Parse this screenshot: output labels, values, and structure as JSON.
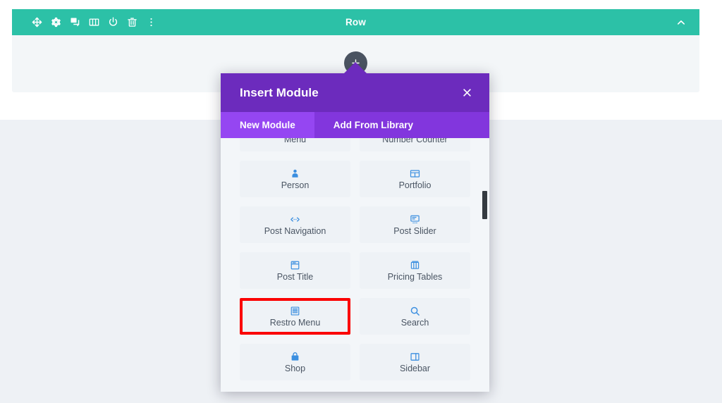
{
  "colors": {
    "row_bar": "#2cc1a7",
    "modal_header": "#6c2bbd",
    "tab_bar": "#8236dd",
    "tab_active": "#9546f2",
    "highlight_border": "#fb0000",
    "module_icon": "#3b8fe0",
    "page_lower": "#eef1f5"
  },
  "row": {
    "title": "Row",
    "tools": [
      {
        "name": "move-icon",
        "title": "Move Row"
      },
      {
        "name": "gear-icon",
        "title": "Row Settings"
      },
      {
        "name": "duplicate-icon",
        "title": "Duplicate Row"
      },
      {
        "name": "columns-icon",
        "title": "Change Column Structure"
      },
      {
        "name": "power-icon",
        "title": "Disable Row"
      },
      {
        "name": "trash-icon",
        "title": "Delete Row"
      },
      {
        "name": "more-options-icon",
        "title": "Other Options"
      }
    ],
    "collapse_icon": "chevron-up-icon"
  },
  "add_button": {
    "icon": "plus-icon",
    "label": "Add New Module"
  },
  "modal": {
    "title": "Insert Module",
    "close_icon": "close-icon",
    "tabs": [
      {
        "label": "New Module",
        "active": true
      },
      {
        "label": "Add From Library",
        "active": false
      }
    ],
    "modules": [
      {
        "label": "Menu",
        "icon": "menu-icon",
        "highlighted": false
      },
      {
        "label": "Number Counter",
        "icon": "number-counter-icon",
        "highlighted": false
      },
      {
        "label": "Person",
        "icon": "person-icon",
        "highlighted": false
      },
      {
        "label": "Portfolio",
        "icon": "portfolio-icon",
        "highlighted": false
      },
      {
        "label": "Post Navigation",
        "icon": "post-navigation-icon",
        "highlighted": false
      },
      {
        "label": "Post Slider",
        "icon": "post-slider-icon",
        "highlighted": false
      },
      {
        "label": "Post Title",
        "icon": "post-title-icon",
        "highlighted": false
      },
      {
        "label": "Pricing Tables",
        "icon": "pricing-tables-icon",
        "highlighted": false
      },
      {
        "label": "Restro Menu",
        "icon": "restro-menu-icon",
        "highlighted": true
      },
      {
        "label": "Search",
        "icon": "search-icon",
        "highlighted": false
      },
      {
        "label": "Shop",
        "icon": "shop-icon",
        "highlighted": false
      },
      {
        "label": "Sidebar",
        "icon": "sidebar-icon",
        "highlighted": false
      }
    ],
    "scrollbar": {
      "name": "modal-scrollbar"
    }
  }
}
